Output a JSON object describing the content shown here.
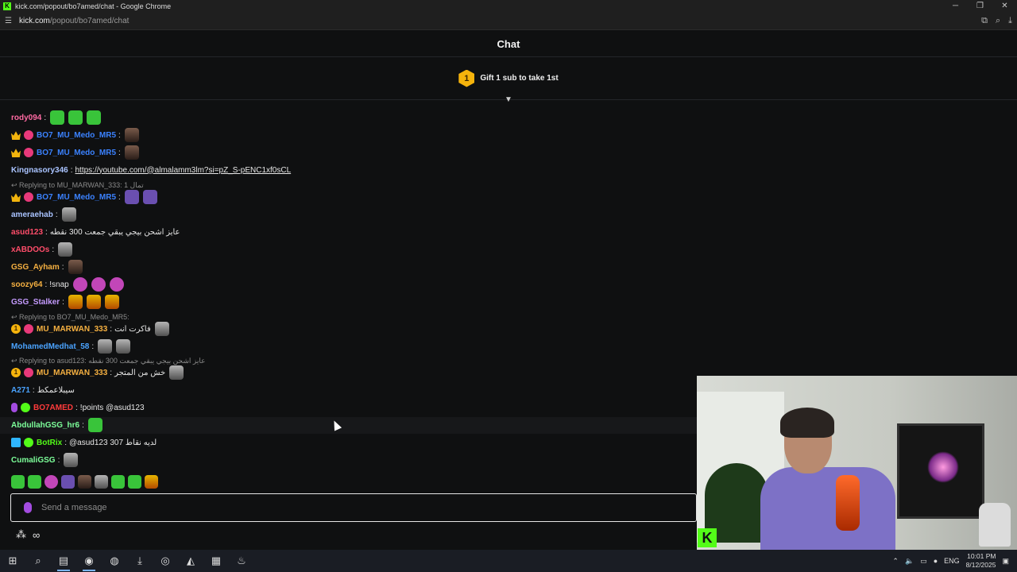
{
  "browser": {
    "window_title": "kick.com/popout/bo7amed/chat - Google Chrome",
    "url_domain": "kick.com",
    "url_path": "/popout/bo7amed/chat"
  },
  "chat": {
    "header_title": "Chat",
    "gift_badge_number": "1",
    "gift_text": "Gift 1 sub to take 1st"
  },
  "messages": [
    {
      "user": "rody094",
      "color": "#ff6aa3",
      "text": "",
      "badges": [],
      "emotes": [
        "green",
        "green",
        "green"
      ]
    },
    {
      "user": "BO7_MU_Medo_MR5",
      "color": "#3b82ff",
      "text": "",
      "badges": [
        "crown",
        "verify"
      ],
      "emotes": [
        "face"
      ]
    },
    {
      "user": "BO7_MU_Medo_MR5",
      "color": "#3b82ff",
      "text": "",
      "badges": [
        "crown",
        "verify"
      ],
      "emotes": [
        "face"
      ]
    },
    {
      "user": "Kingnasory346",
      "color": "#a9c3ff",
      "link": "https://youtube.com/@almalamm3lm?si=pZ_S-pENC1xf0sCL",
      "badges": [],
      "emotes": []
    },
    {
      "reply": "Replying to MU_MARWAN_333: تمال 1"
    },
    {
      "user": "BO7_MU_Medo_MR5",
      "color": "#3b82ff",
      "text": "",
      "badges": [
        "crown",
        "verify"
      ],
      "emotes": [
        "purple",
        "purple"
      ]
    },
    {
      "user": "ameraehab",
      "color": "#a9c3ff",
      "text": "",
      "badges": [],
      "emotes": [
        "grey"
      ]
    },
    {
      "user": "asud123",
      "color": "#ff4d6a",
      "text": "عايز اشحن بيجي يبقي جمعت 300 نقطه",
      "badges": [],
      "emotes": []
    },
    {
      "user": "xABDOOs",
      "color": "#ff4d6a",
      "text": "",
      "badges": [],
      "emotes": [
        "grey"
      ]
    },
    {
      "user": "GSG_Ayham",
      "color": "#f5b041",
      "text": "",
      "badges": [],
      "emotes": [
        "face"
      ]
    },
    {
      "user": "soozy64",
      "color": "#f5b041",
      "text": "!snap",
      "badges": [],
      "emotes": [
        "pink",
        "pink",
        "pink"
      ]
    },
    {
      "user": "GSG_Stalker",
      "color": "#c59bff",
      "text": "",
      "badges": [],
      "emotes": [
        "fire",
        "fire",
        "fire"
      ]
    },
    {
      "reply": "Replying to BO7_MU_Medo_MR5:"
    },
    {
      "user": "MU_MARWAN_333",
      "color": "#f5b041",
      "text": "فاكرت انت",
      "badges": [
        "one",
        "verify"
      ],
      "emotes": [
        "grey"
      ]
    },
    {
      "user": "MohamedMedhat_58",
      "color": "#4aa3ff",
      "text": "",
      "badges": [],
      "emotes": [
        "grey",
        "grey"
      ]
    },
    {
      "reply": "Replying to asud123: عايز اشحن بيجي يبقي جمعت 300 نقطه"
    },
    {
      "user": "MU_MARWAN_333",
      "color": "#f5b041",
      "text": "خش من المتجر",
      "badges": [
        "one",
        "verify"
      ],
      "emotes": [
        "grey"
      ]
    },
    {
      "user": "A271",
      "color": "#4aa3ff",
      "text": "سيبلاعمكط",
      "badges": [],
      "emotes": []
    },
    {
      "user": "BO7AMED",
      "color": "#ff3b3b",
      "text": "!points @asud123",
      "badges": [
        "mic",
        "verify-g"
      ],
      "emotes": []
    },
    {
      "user": "AbdullahGSG_hr6",
      "color": "#7dff9a",
      "text": "",
      "badges": [],
      "emotes": [
        "green"
      ]
    },
    {
      "user": "BotRix",
      "color": "#53fc18",
      "text": "@asud123 307 لديه نقاط",
      "badges": [
        "bot",
        "verify-g"
      ],
      "emotes": []
    },
    {
      "user": "CumaliGSG",
      "color": "#7dff9a",
      "text": "",
      "badges": [],
      "emotes": [
        "grey"
      ]
    }
  ],
  "input": {
    "placeholder": "Send a message"
  },
  "taskbar": {
    "lang": "ENG",
    "time": "10:01 PM",
    "date": "8/12/2025"
  }
}
